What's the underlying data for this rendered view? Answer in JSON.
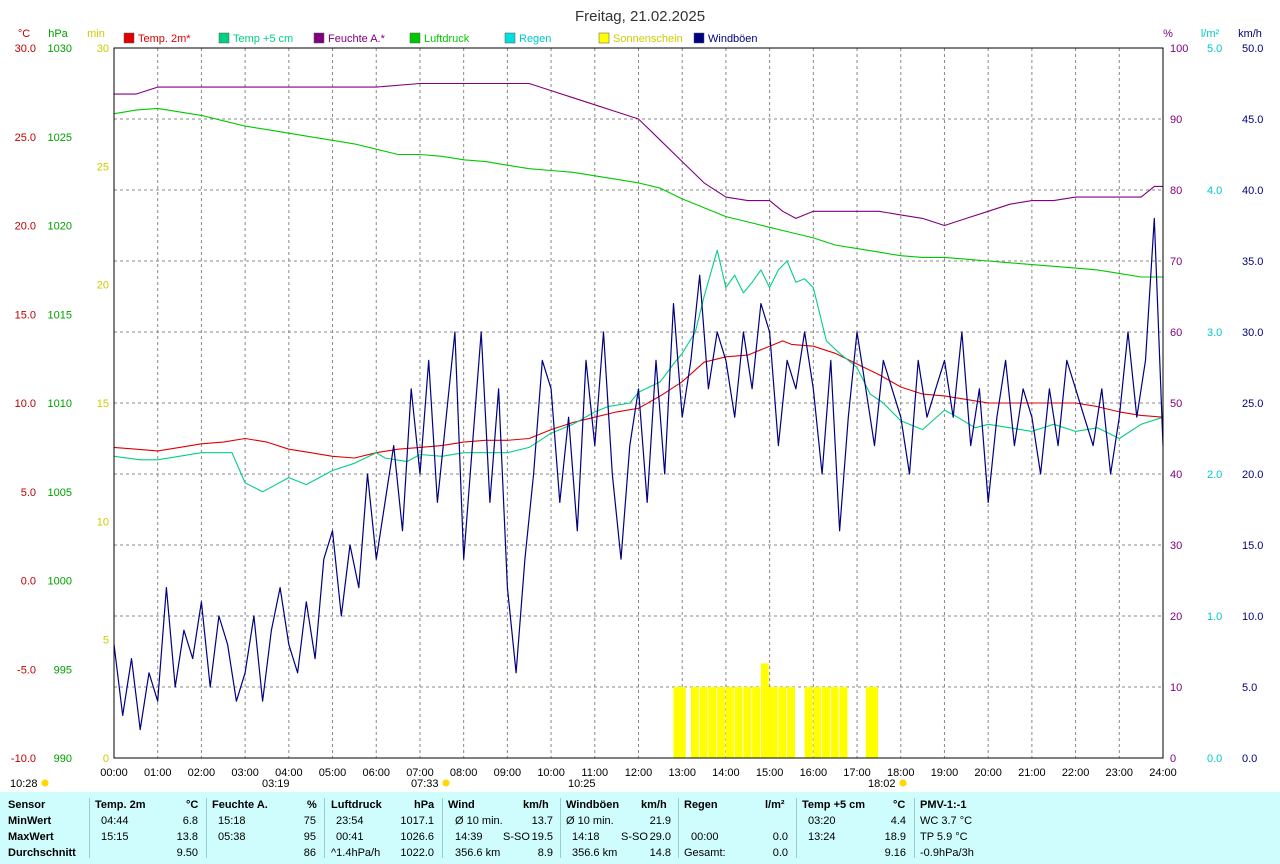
{
  "chart_data": {
    "type": "line",
    "title": "Freitag, 21.02.2025",
    "x_ticks": [
      "00:00",
      "01:00",
      "02:00",
      "03:00",
      "04:00",
      "05:00",
      "06:00",
      "07:00",
      "08:00",
      "09:00",
      "10:00",
      "11:00",
      "12:00",
      "13:00",
      "14:00",
      "15:00",
      "16:00",
      "17:00",
      "18:00",
      "19:00",
      "20:00",
      "21:00",
      "22:00",
      "23:00",
      "24:00"
    ],
    "x_range_hours": [
      0,
      24
    ],
    "grid": true,
    "legend_position": "top",
    "axes": {
      "temp": {
        "unit": "°C",
        "range": [
          -10,
          30
        ],
        "ticks": [
          "30.0",
          "25.0",
          "20.0",
          "15.0",
          "10.0",
          "5.0",
          "0.0",
          "-5.0",
          "-10.0"
        ],
        "color": "#c00000"
      },
      "pressure": {
        "unit": "hPa",
        "range": [
          990,
          1030
        ],
        "ticks": [
          "1030",
          "1025",
          "1020",
          "1015",
          "1010",
          "1005",
          "1000",
          "995",
          "990"
        ],
        "color": "#00a000"
      },
      "sunshine": {
        "unit": "min",
        "range": [
          0,
          30
        ],
        "ticks": [
          "30",
          "25",
          "20",
          "15",
          "10",
          "5",
          "0"
        ],
        "color": "#cccc00"
      },
      "humidity": {
        "unit": "%",
        "range": [
          0,
          100
        ],
        "ticks": [
          "100",
          "90",
          "80",
          "70",
          "60",
          "50",
          "40",
          "30",
          "20",
          "10",
          "0"
        ],
        "color": "#800080"
      },
      "rain": {
        "unit": "l/m²",
        "range": [
          0,
          5
        ],
        "ticks": [
          "5.0",
          "4.0",
          "3.0",
          "2.0",
          "1.0",
          "0.0"
        ],
        "color": "#00c8c8"
      },
      "wind": {
        "unit": "km/h",
        "range": [
          0,
          50
        ],
        "ticks": [
          "50.0",
          "45.0",
          "40.0",
          "35.0",
          "30.0",
          "25.0",
          "20.0",
          "15.0",
          "10.0",
          "5.0",
          "0.0"
        ],
        "color": "#000080"
      }
    },
    "series": [
      {
        "name": "Temp. 2m*",
        "color": "#e00000",
        "axis": "temp",
        "x": [
          0,
          1,
          1.5,
          2,
          2.5,
          3,
          3.5,
          4,
          4.5,
          5,
          5.5,
          6,
          6.5,
          7,
          7.5,
          8,
          8.5,
          9,
          9.5,
          10,
          10.5,
          11,
          11.5,
          12,
          12.5,
          13,
          13.5,
          14,
          14.5,
          15,
          15.3,
          15.5,
          16,
          16.5,
          17,
          17.5,
          18,
          18.5,
          19,
          19.5,
          20,
          20.5,
          21,
          21.5,
          22,
          22.5,
          23,
          23.5,
          24
        ],
        "y": [
          7.5,
          7.3,
          7.5,
          7.7,
          7.8,
          8.0,
          7.8,
          7.4,
          7.2,
          7.0,
          6.9,
          7.2,
          7.4,
          7.5,
          7.6,
          7.8,
          7.9,
          7.9,
          8.0,
          8.5,
          8.9,
          9.2,
          9.5,
          9.7,
          10.4,
          11.2,
          12.3,
          12.6,
          12.7,
          13.2,
          13.5,
          13.3,
          13.2,
          12.8,
          12.2,
          11.6,
          10.9,
          10.5,
          10.4,
          10.2,
          10.0,
          10.0,
          10.0,
          10.0,
          10.0,
          9.8,
          9.5,
          9.3,
          9.2
        ]
      },
      {
        "name": "Temp +5 cm",
        "color": "#00d080",
        "axis": "temp",
        "x": [
          0,
          0.6,
          1,
          2,
          2.7,
          3,
          3.4,
          4,
          4.4,
          5,
          5.5,
          6,
          6.2,
          6.7,
          7,
          7.5,
          8,
          8.5,
          9,
          9.5,
          10,
          10.5,
          11,
          11.3,
          11.8,
          12,
          12.5,
          12.8,
          13,
          13.3,
          13.5,
          13.8,
          14,
          14.2,
          14.4,
          14.6,
          14.8,
          15,
          15.2,
          15.4,
          15.6,
          15.8,
          16,
          16.3,
          16.6,
          17,
          17.3,
          17.6,
          18,
          18.5,
          19,
          19.3,
          19.7,
          20,
          20.5,
          21,
          21.5,
          22,
          22.5,
          23,
          23.5,
          24
        ],
        "y": [
          7.0,
          6.8,
          6.8,
          7.2,
          7.2,
          5.5,
          5.0,
          5.8,
          5.4,
          6.2,
          6.6,
          7.2,
          6.9,
          6.7,
          7.1,
          7.0,
          7.2,
          7.2,
          7.2,
          7.5,
          8.3,
          8.8,
          9.5,
          9.8,
          10.0,
          10.6,
          11.2,
          12.2,
          12.8,
          14.0,
          16.0,
          18.6,
          16.5,
          17.2,
          16.2,
          16.8,
          17.5,
          16.5,
          17.5,
          18.0,
          16.8,
          17.0,
          16.5,
          13.5,
          12.8,
          12.0,
          10.5,
          10.0,
          9.0,
          8.5,
          9.6,
          9.2,
          8.6,
          8.8,
          8.6,
          8.4,
          8.8,
          8.4,
          8.6,
          8.0,
          8.8,
          9.2
        ]
      },
      {
        "name": "Feuchte A.*",
        "color": "#800080",
        "axis": "humidity",
        "x": [
          0,
          0.5,
          1,
          2,
          3,
          4,
          5,
          5.5,
          6,
          7,
          8,
          9,
          9.5,
          10,
          10.5,
          11,
          11.5,
          12,
          12.5,
          13,
          13.5,
          14,
          14.5,
          15,
          15.3,
          15.6,
          16,
          16.5,
          17,
          17.5,
          18,
          18.5,
          19,
          19.5,
          20,
          20.5,
          21,
          21.5,
          22,
          22.5,
          23,
          23.5,
          23.8,
          24
        ],
        "y": [
          93.5,
          93.5,
          94.5,
          94.5,
          94.5,
          94.5,
          94.5,
          94.5,
          94.5,
          95.0,
          95.0,
          95.0,
          95.0,
          94.0,
          93.0,
          92.0,
          91.0,
          90.0,
          87.0,
          84.0,
          81.0,
          79.0,
          78.5,
          78.5,
          77.0,
          76.0,
          77.0,
          77.0,
          77.0,
          77.0,
          76.5,
          76.0,
          75.0,
          76.0,
          77.0,
          78.0,
          78.5,
          78.5,
          79.0,
          79.0,
          79.0,
          79.0,
          80.5,
          80.5
        ]
      },
      {
        "name": "Luftdruck",
        "color": "#00c800",
        "axis": "pressure",
        "x": [
          0,
          0.5,
          1,
          1.5,
          2,
          2.5,
          3,
          3.5,
          4,
          4.5,
          5,
          5.5,
          6,
          6.5,
          7,
          7.5,
          8,
          8.5,
          9,
          9.5,
          10,
          10.5,
          11,
          11.5,
          12,
          12.5,
          13,
          13.5,
          14,
          14.5,
          15,
          15.5,
          16,
          16.5,
          17,
          17.5,
          18,
          18.5,
          19,
          19.5,
          20,
          20.5,
          21,
          21.5,
          22,
          22.5,
          23,
          23.5,
          24
        ],
        "y": [
          1026.3,
          1026.5,
          1026.6,
          1026.4,
          1026.2,
          1025.9,
          1025.6,
          1025.4,
          1025.2,
          1025.0,
          1024.8,
          1024.6,
          1024.3,
          1024.0,
          1024.0,
          1023.9,
          1023.7,
          1023.6,
          1023.4,
          1023.2,
          1023.1,
          1023.0,
          1022.8,
          1022.6,
          1022.4,
          1022.1,
          1021.5,
          1021.0,
          1020.5,
          1020.2,
          1019.9,
          1019.6,
          1019.3,
          1018.9,
          1018.7,
          1018.5,
          1018.3,
          1018.2,
          1018.2,
          1018.1,
          1018.0,
          1017.9,
          1017.8,
          1017.7,
          1017.6,
          1017.5,
          1017.3,
          1017.1,
          1017.1
        ]
      },
      {
        "name": "Regen",
        "color": "#00e0e0",
        "axis": "rain",
        "x": [
          0,
          24
        ],
        "y": [
          0,
          0
        ]
      },
      {
        "name": "Sonnenschein",
        "color": "#ffff00",
        "axis": "sunshine",
        "x": [
          12.8,
          12.9,
          13.0,
          13.2,
          13.4,
          13.6,
          13.8,
          14.0,
          14.2,
          14.4,
          14.6,
          14.8,
          14.9,
          15.0,
          15.2,
          15.4,
          15.6,
          15.8,
          16.0,
          16.2,
          16.4,
          16.6,
          17.2,
          17.3
        ],
        "y": [
          3,
          3,
          0,
          3,
          3,
          3,
          3,
          3,
          3,
          3,
          3,
          4,
          3,
          3,
          3,
          3,
          0,
          3,
          3,
          3,
          3,
          3,
          3,
          3
        ]
      },
      {
        "name": "Windböen",
        "color": "#000080",
        "axis": "wind",
        "x": [
          0,
          0.2,
          0.4,
          0.6,
          0.8,
          1.0,
          1.2,
          1.4,
          1.6,
          1.8,
          2.0,
          2.2,
          2.4,
          2.6,
          2.8,
          3.0,
          3.2,
          3.4,
          3.6,
          3.8,
          4.0,
          4.2,
          4.4,
          4.6,
          4.8,
          5.0,
          5.2,
          5.4,
          5.6,
          5.8,
          6.0,
          6.2,
          6.4,
          6.6,
          6.8,
          7.0,
          7.2,
          7.4,
          7.6,
          7.8,
          8.0,
          8.2,
          8.4,
          8.6,
          8.8,
          9.0,
          9.2,
          9.4,
          9.6,
          9.8,
          10.0,
          10.2,
          10.4,
          10.6,
          10.8,
          11.0,
          11.2,
          11.4,
          11.6,
          11.8,
          12.0,
          12.2,
          12.4,
          12.6,
          12.8,
          13.0,
          13.2,
          13.4,
          13.6,
          13.8,
          14.0,
          14.2,
          14.4,
          14.6,
          14.8,
          15.0,
          15.2,
          15.4,
          15.6,
          15.8,
          16.0,
          16.2,
          16.4,
          16.6,
          16.8,
          17.0,
          17.2,
          17.4,
          17.6,
          17.8,
          18.0,
          18.2,
          18.4,
          18.6,
          18.8,
          19.0,
          19.2,
          19.4,
          19.6,
          19.8,
          20.0,
          20.2,
          20.4,
          20.6,
          20.8,
          21.0,
          21.2,
          21.4,
          21.6,
          21.8,
          22.0,
          22.2,
          22.4,
          22.6,
          22.8,
          23.0,
          23.2,
          23.4,
          23.6,
          23.8,
          24.0
        ],
        "y": [
          8,
          3,
          7,
          2,
          6,
          4,
          12,
          5,
          9,
          7,
          11,
          5,
          10,
          8,
          4,
          6,
          10,
          4,
          9,
          12,
          8,
          6,
          11,
          7,
          14,
          16,
          10,
          15,
          12,
          20,
          14,
          18,
          22,
          16,
          26,
          20,
          28,
          18,
          24,
          30,
          14,
          22,
          30,
          18,
          26,
          12,
          6,
          14,
          20,
          28,
          26,
          18,
          24,
          16,
          28,
          22,
          30,
          20,
          14,
          22,
          26,
          18,
          28,
          20,
          32,
          24,
          28,
          34,
          26,
          30,
          28,
          24,
          30,
          26,
          32,
          30,
          22,
          28,
          26,
          30,
          26,
          20,
          28,
          16,
          24,
          30,
          26,
          22,
          28,
          26,
          24,
          20,
          28,
          24,
          26,
          28,
          24,
          30,
          22,
          26,
          18,
          24,
          28,
          22,
          26,
          24,
          20,
          26,
          22,
          28,
          26,
          24,
          22,
          26,
          20,
          24,
          30,
          24,
          28,
          38,
          22
        ]
      }
    ]
  },
  "legend": [
    {
      "label": "Temp. 2m*",
      "color": "#e00000"
    },
    {
      "label": "Temp +5 cm",
      "color": "#00d080"
    },
    {
      "label": "Feuchte A.*",
      "color": "#800080"
    },
    {
      "label": "Luftdruck",
      "color": "#00c800"
    },
    {
      "label": "Regen",
      "color": "#00e0e0"
    },
    {
      "label": "Sonnenschein",
      "color": "#ffff00"
    },
    {
      "label": "Windböen",
      "color": "#000080"
    }
  ],
  "markers": {
    "sunrise": "07:33",
    "sunset": "18:02",
    "left_time": "10:28",
    "moon1": "03:19",
    "moon2": "10:25"
  },
  "stats": {
    "row_labels": [
      "Sensor",
      "MinWert",
      "MaxWert",
      "Durchschnitt"
    ],
    "temp2m": {
      "header": "Temp. 2m",
      "unit": "°C",
      "min_time": "04:44",
      "min": "6.8",
      "max_time": "15:15",
      "max": "13.8",
      "avg": "9.50"
    },
    "humidity": {
      "header": "Feuchte A.",
      "unit": "%",
      "min_time": "15:18",
      "min": "75",
      "max_time": "05:38",
      "max": "95",
      "avg": "86"
    },
    "pressure": {
      "header": "Luftdruck",
      "unit": "hPa",
      "min_time": "23:54",
      "min": "1017.1",
      "max_time": "00:41",
      "max": "1026.6",
      "trend": "^1.4hPa/h",
      "avg": "1022.0"
    },
    "wind": {
      "header": "Wind",
      "unit": "km/h",
      "r1_label": "Ø 10 min.",
      "r1_value": "13.7",
      "r2_time": "14:39",
      "r2_dir": "S-SO",
      "r2_value": "19.5",
      "r3_dist": "356.6 km",
      "r3_value": "8.9"
    },
    "gusts": {
      "header": "Windböen",
      "unit": "km/h",
      "r1_label": "Ø 10 min.",
      "r1_value": "21.9",
      "r2_time": "14:18",
      "r2_dir": "S-SO",
      "r2_value": "29.0",
      "r3_dist": "356.6 km",
      "r3_value": "14.8"
    },
    "rain": {
      "header": "Regen",
      "unit": "l/m²",
      "r2_time": "00:00",
      "r2_value": "0.0",
      "r3_label": "Gesamt:",
      "r3_value": "0.0"
    },
    "temp5cm": {
      "header": "Temp +5 cm",
      "unit": "°C",
      "min_time": "03:20",
      "min": "4.4",
      "max_time": "13:24",
      "max": "18.9",
      "avg": "9.16"
    },
    "pmv": {
      "header": "PMV-1:-1",
      "wc": "WC 3.7 °C",
      "tp": "TP 5.9 °C",
      "trend": "-0.9hPa/3h"
    }
  }
}
